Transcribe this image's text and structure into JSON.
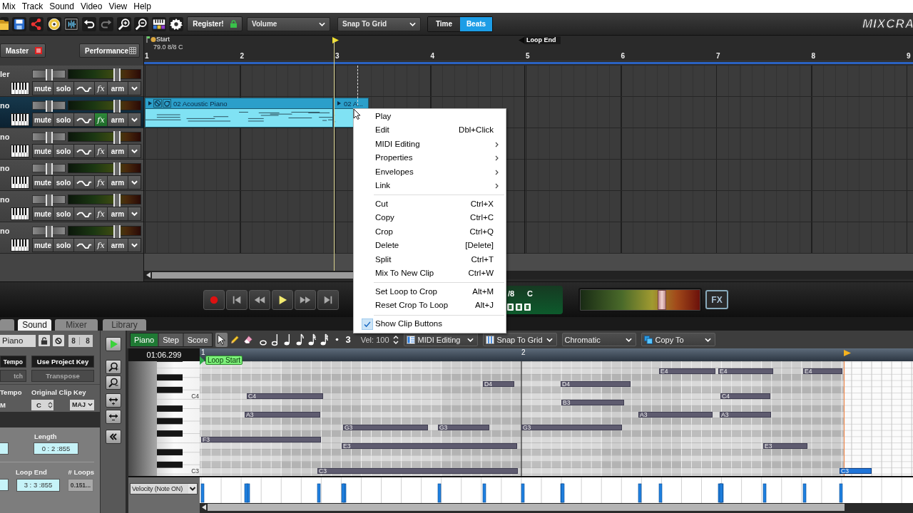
{
  "menu_bar": [
    "Mix",
    "Track",
    "Sound",
    "Video",
    "View",
    "Help"
  ],
  "toolbar": {
    "register_button": "Register!",
    "dropdowns": [
      "Volume",
      "Snap To Grid"
    ],
    "time_modes": [
      {
        "label": "Time",
        "selected": false
      },
      {
        "label": "Beats",
        "selected": true
      }
    ],
    "logo": "MIXCRA"
  },
  "track_header": {
    "master_button": "Master",
    "performance_button": "Performance"
  },
  "tracks": [
    {
      "name": "ler",
      "selected": false,
      "pan": {
        "level": 0.5
      },
      "volume": {
        "level": 0.67
      },
      "buttons": [
        {
          "label": "mute",
          "on": false
        },
        {
          "label": "solo",
          "on": false
        },
        {
          "label": "fx",
          "on": false
        },
        {
          "label": "arm",
          "on": false
        }
      ]
    },
    {
      "name": "no",
      "selected": true,
      "pan": {
        "level": 0.5
      },
      "volume": {
        "level": 0.67
      },
      "buttons": [
        {
          "label": "mute",
          "on": false
        },
        {
          "label": "solo",
          "on": false
        },
        {
          "label": "fx",
          "on": true
        },
        {
          "label": "arm",
          "on": false
        }
      ],
      "clips": [
        {
          "name": "02 Acoustic Piano"
        },
        {
          "name": "02 A..."
        }
      ]
    },
    {
      "name": "no",
      "selected": false,
      "pan": {
        "level": 0.5
      },
      "volume": {
        "level": 0.67
      },
      "buttons": [
        {
          "label": "mute",
          "on": false
        },
        {
          "label": "solo",
          "on": false
        },
        {
          "label": "fx",
          "on": false
        },
        {
          "label": "arm",
          "on": false
        }
      ]
    },
    {
      "name": "no",
      "selected": false,
      "pan": {
        "level": 0.5
      },
      "volume": {
        "level": 0.67
      },
      "buttons": [
        {
          "label": "mute",
          "on": false
        },
        {
          "label": "solo",
          "on": false
        },
        {
          "label": "fx",
          "on": false
        },
        {
          "label": "arm",
          "on": false
        }
      ]
    },
    {
      "name": "no",
      "selected": false,
      "pan": {
        "level": 0.5
      },
      "volume": {
        "level": 0.67
      },
      "buttons": [
        {
          "label": "mute",
          "on": false
        },
        {
          "label": "solo",
          "on": false
        },
        {
          "label": "fx",
          "on": false
        },
        {
          "label": "arm",
          "on": false
        }
      ]
    },
    {
      "name": "no",
      "selected": false,
      "pan": {
        "level": 0.5
      },
      "volume": {
        "level": 0.67
      },
      "buttons": [
        {
          "label": "mute",
          "on": false
        },
        {
          "label": "solo",
          "on": false
        },
        {
          "label": "fx",
          "on": false
        },
        {
          "label": "arm",
          "on": false
        }
      ]
    }
  ],
  "timeline": {
    "start_marker": "Start",
    "tempo_info": "79.0 8/8 C",
    "loop_end_marker": "Loop End",
    "bars": [
      "1",
      "2",
      "3",
      "4",
      "5",
      "6",
      "7",
      "8",
      "9"
    ]
  },
  "context_menu": {
    "sections": [
      [
        {
          "label": "Play",
          "submenu": false,
          "checked": false
        },
        {
          "label": "Edit",
          "shortcut": "Dbl+Click",
          "submenu": false,
          "checked": false
        },
        {
          "label": "MIDI Editing",
          "submenu": true,
          "checked": false
        },
        {
          "label": "Properties",
          "submenu": true,
          "checked": false
        },
        {
          "label": "Envelopes",
          "submenu": true,
          "checked": false
        },
        {
          "label": "Link",
          "submenu": true,
          "checked": false
        }
      ],
      [
        {
          "label": "Cut",
          "shortcut": "Ctrl+X",
          "submenu": false,
          "checked": false
        },
        {
          "label": "Copy",
          "shortcut": "Ctrl+C",
          "submenu": false,
          "checked": false
        },
        {
          "label": "Crop",
          "shortcut": "Ctrl+Q",
          "submenu": false,
          "checked": false
        },
        {
          "label": "Delete",
          "shortcut": "[Delete]",
          "submenu": false,
          "checked": false
        },
        {
          "label": "Split",
          "shortcut": "Ctrl+T",
          "submenu": false,
          "checked": false
        },
        {
          "label": "Mix To New Clip",
          "shortcut": "Ctrl+W",
          "submenu": false,
          "checked": false
        }
      ],
      [
        {
          "label": "Set Loop to Crop",
          "shortcut": "Alt+M",
          "submenu": false,
          "checked": false
        },
        {
          "label": "Reset Crop To Loop",
          "shortcut": "Alt+J",
          "submenu": false,
          "checked": false
        }
      ],
      [
        {
          "label": "Show Clip Buttons",
          "submenu": false,
          "checked": true
        }
      ]
    ]
  },
  "transport": {
    "time_signature": "/8",
    "key": "C",
    "master_volume": {
      "level": 0.68
    },
    "fx_button": "FX"
  },
  "bottom_tabs": [
    {
      "label": "Sound",
      "selected": true
    },
    {
      "label": "Mixer",
      "selected": false
    },
    {
      "label": "Library",
      "selected": false
    }
  ],
  "sound_panel": {
    "clip_name": "Piano",
    "numerator": "8",
    "denominator": "8",
    "tempo_mode": [
      {
        "label": "Tempo",
        "selected": true
      },
      {
        "label": "tch",
        "selected": false
      }
    ],
    "key_mode": [
      {
        "label": "Use Project Key",
        "selected": true
      },
      {
        "label": "Transpose",
        "selected": false
      }
    ],
    "tempo_label": "Tempo",
    "tempo_value": "M",
    "clip_key_label": "Original Clip Key",
    "clip_key": "C",
    "clip_scale": "MAJ",
    "length_label": "Length",
    "length": "0 : 2 :855",
    "loop_end_label": "Loop End",
    "loop_end": "3 : 3 :855",
    "loops_label": "# Loops",
    "loops": "0.151..."
  },
  "piano_roll": {
    "modes": [
      {
        "label": "Piano",
        "selected": true
      },
      {
        "label": "Step",
        "selected": false
      },
      {
        "label": "Score",
        "selected": false
      }
    ],
    "tools": [
      {
        "kind": "pointer",
        "selected": true
      },
      {
        "kind": "pencil",
        "selected": false
      },
      {
        "kind": "eraser",
        "selected": false
      }
    ],
    "triplet": "3",
    "velocity": "Vel: 100",
    "dropdowns": [
      "MIDI Editing",
      "Snap To Grid",
      "Chromatic",
      "Copy To"
    ],
    "time_readout": "01:06.299",
    "bars": [
      "1",
      "2"
    ],
    "loop_start_marker": "Loop Start",
    "key_labels": [
      "C4",
      "C3"
    ],
    "notes": [
      {
        "label": "E4",
        "selected": false
      },
      {
        "label": "E4",
        "selected": false
      },
      {
        "label": "E4",
        "selected": false
      },
      {
        "label": "D4",
        "selected": false
      },
      {
        "label": "D4",
        "selected": false
      },
      {
        "label": "C4",
        "selected": false
      },
      {
        "label": "C4",
        "selected": false
      },
      {
        "label": "B3",
        "selected": false
      },
      {
        "label": "A3",
        "selected": false
      },
      {
        "label": "A3",
        "selected": false
      },
      {
        "label": "A3",
        "selected": false
      },
      {
        "label": "G3",
        "selected": false
      },
      {
        "label": "G3",
        "selected": false
      },
      {
        "label": "G3",
        "selected": false
      },
      {
        "label": "F3",
        "selected": false
      },
      {
        "label": "E3",
        "selected": false
      },
      {
        "label": "E3",
        "selected": false
      },
      {
        "label": "C3",
        "selected": false
      },
      {
        "label": "C3",
        "selected": true
      }
    ],
    "velocity_lane": "Velocity (Note ON)"
  }
}
